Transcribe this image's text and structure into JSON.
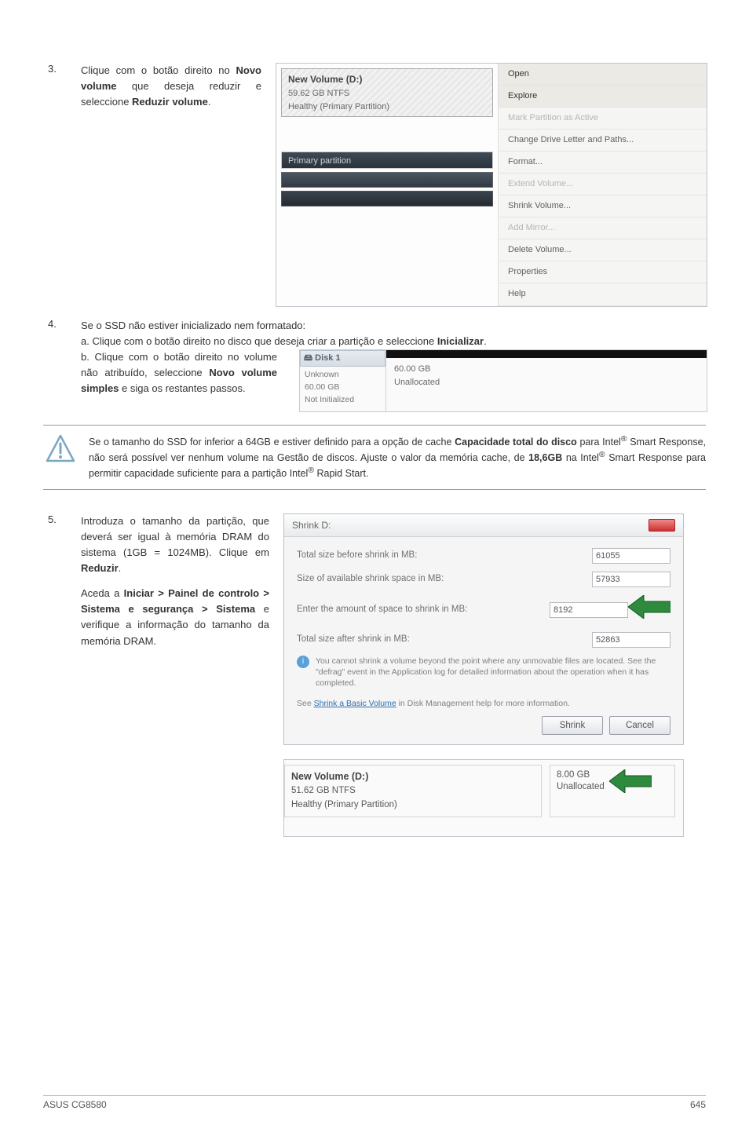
{
  "step3": {
    "num": "3.",
    "text_before": "Clique com o botão direito no ",
    "bold1": "Novo volume",
    "text_mid": " que deseja reduzir e seleccione ",
    "bold2": "Reduzir volume",
    "text_after": ".",
    "vol_title": "New Volume  (D:)",
    "vol_size": "59.62 GB NTFS",
    "vol_health": "Healthy (Primary Partition)",
    "primary_partition": "Primary partition",
    "menu": {
      "open": "Open",
      "explore": "Explore",
      "mark": "Mark Partition as Active",
      "change": "Change Drive Letter and Paths...",
      "format": "Format...",
      "extend": "Extend Volume...",
      "shrink": "Shrink Volume...",
      "addmirror": "Add Mirror...",
      "delete": "Delete Volume...",
      "props": "Properties",
      "help": "Help"
    }
  },
  "step4": {
    "num": "4.",
    "line1": "Se o SSD não estiver inicializado nem formatado:",
    "a": "a. Clique com o botão direito no disco que deseja criar a partição e seleccione ",
    "a_bold": "Inicializar",
    "a_after": ".",
    "b_before": "b. Clique com o botão direito no volume não atribuído, seleccione ",
    "b_bold": "Novo volume simples",
    "b_after": " e siga os restantes passos.",
    "disk_label": "Disk 1",
    "unknown": "Unknown",
    "size": "60.00 GB",
    "notinit": "Not Initialized",
    "rsize": "60.00 GB",
    "unalloc": "Unallocated"
  },
  "warning": {
    "text_a": "Se o tamanho do SSD for inferior a 64GB e estiver definido para a opção de cache ",
    "bold_cap": "Capacidade total do disco",
    "text_b": " para Intel",
    "reg": "®",
    "text_c": " Smart Response, não será possível ver nenhum volume na Gestão de discos. Ajuste o valor da memória cache, de ",
    "bold_186": "18,6GB",
    "text_d": " na Intel",
    "text_e": " Smart Response para permitir capacidade suficiente para a partição Intel",
    "text_f": " Rapid Start."
  },
  "step5": {
    "num": "5.",
    "para1_a": "Introduza o tamanho da partição, que deverá ser igual à memória DRAM do sistema (1GB = 1024MB). Clique em ",
    "para1_bold": "Reduzir",
    "para1_b": ".",
    "para2_a": "Aceda a ",
    "para2_bold": "Iniciar > Painel de controlo > Sistema e segurança > Sistema",
    "para2_b": " e verifique a informação do tamanho da memória DRAM.",
    "dlg_title": "Shrink D:",
    "row1": "Total size before shrink in MB:",
    "row1v": "61055",
    "row2": "Size of available shrink space in MB:",
    "row2v": "57933",
    "row3": "Enter the amount of space to shrink in MB:",
    "row3v": "8192",
    "row4": "Total size after shrink in MB:",
    "row4v": "52863",
    "info": "You cannot shrink a volume beyond the point where any unmovable files are located. See the \"defrag\" event in the Application log for detailed information about the operation when it has completed.",
    "see_a": "See ",
    "see_link": "Shrink a Basic Volume",
    "see_b": " in Disk Management help for more information.",
    "btn_shrink": "Shrink",
    "btn_cancel": "Cancel",
    "after_title": "New Volume  (D:)",
    "after_size": "51.62 GB NTFS",
    "after_health": "Healthy (Primary Partition)",
    "after_rsize": "8.00 GB",
    "after_unalloc": "Unallocated"
  },
  "footer": {
    "left": "ASUS CG8580",
    "right": "645"
  }
}
